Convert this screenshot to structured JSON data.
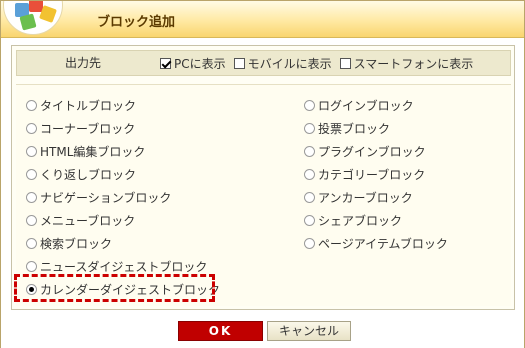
{
  "colors": {
    "accent": "#c00000",
    "title_bg": "#ffe9a3",
    "highlight": "#cc0000"
  },
  "dialog": {
    "title": "ブロック追加"
  },
  "output": {
    "label": "出力先",
    "checks": [
      {
        "label": "PCに表示",
        "checked": true
      },
      {
        "label": "モバイルに表示",
        "checked": false
      },
      {
        "label": "スマートフォンに表示",
        "checked": false
      }
    ]
  },
  "blocks": {
    "left": [
      "タイトルブロック",
      "コーナーブロック",
      "HTML編集ブロック",
      "くり返しブロック",
      "ナビゲーションブロック",
      "メニューブロック",
      "検索ブロック",
      "ニュースダイジェストブロック",
      "カレンダーダイジェストブロック"
    ],
    "right": [
      "ログインブロック",
      "投票ブロック",
      "プラグインブロック",
      "カテゴリーブロック",
      "アンカーブロック",
      "シェアブロック",
      "ページアイテムブロック"
    ],
    "selected": "カレンダーダイジェストブロック"
  },
  "buttons": {
    "ok": "OK",
    "cancel": "キャンセル"
  }
}
